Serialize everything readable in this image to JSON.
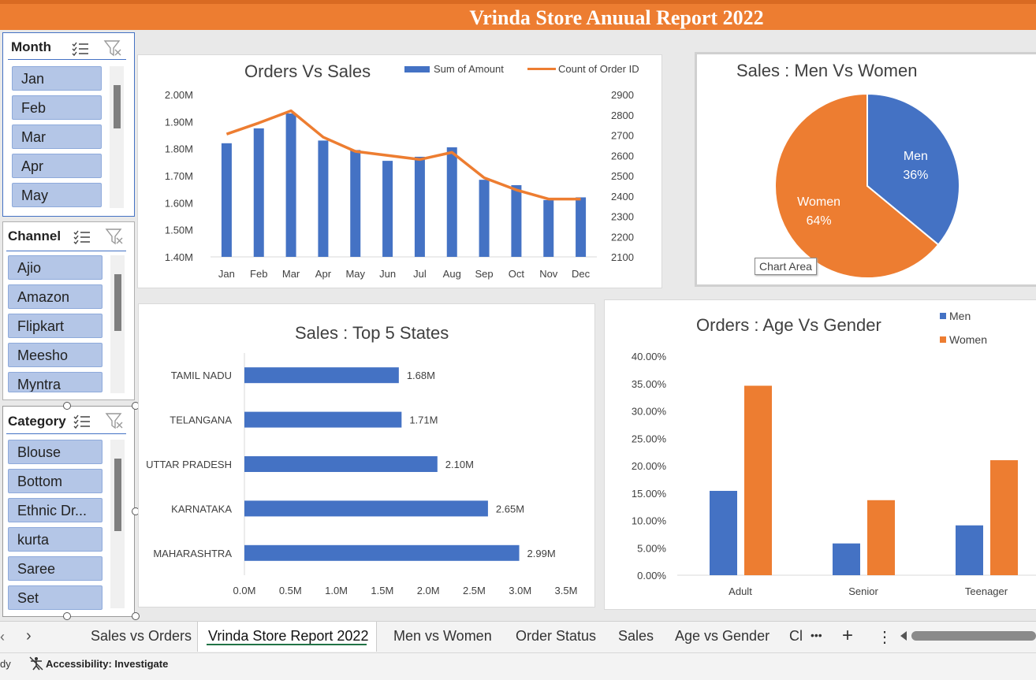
{
  "header": {
    "title": "Vrinda Store Anuual Report 2022"
  },
  "slicers": {
    "month": {
      "title": "Month",
      "items": [
        "Jan",
        "Feb",
        "Mar",
        "Apr",
        "May"
      ]
    },
    "channel": {
      "title": "Channel",
      "items": [
        "Ajio",
        "Amazon",
        "Flipkart",
        "Meesho",
        "Myntra"
      ]
    },
    "category": {
      "title": "Category",
      "items": [
        "Blouse",
        "Bottom",
        "Ethnic Dr...",
        "kurta",
        "Saree",
        "Set"
      ]
    }
  },
  "chart_data": [
    {
      "type": "bar",
      "title": "Orders Vs Sales",
      "categories": [
        "Jan",
        "Feb",
        "Mar",
        "Apr",
        "May",
        "Jun",
        "Jul",
        "Aug",
        "Sep",
        "Oct",
        "Nov",
        "Dec"
      ],
      "series": [
        {
          "name": "Sum of Amount",
          "type": "bar",
          "axis": "left",
          "color": "#4472c4",
          "values": [
            1.82,
            1.875,
            1.93,
            1.83,
            1.795,
            1.755,
            1.77,
            1.805,
            1.685,
            1.665,
            1.61,
            1.62
          ]
        },
        {
          "name": "Count of Order ID",
          "type": "line",
          "axis": "right",
          "color": "#ed7d31",
          "values": [
            2705,
            2760,
            2820,
            2690,
            2620,
            2600,
            2580,
            2615,
            2490,
            2430,
            2385,
            2385
          ]
        }
      ],
      "y_left_ticks": [
        "2.00M",
        "1.90M",
        "1.80M",
        "1.70M",
        "1.60M",
        "1.50M",
        "1.40M"
      ],
      "ylim_left": [
        1.4,
        2.0
      ],
      "y_right_ticks": [
        "2900",
        "2800",
        "2700",
        "2600",
        "2500",
        "2400",
        "2300",
        "2200",
        "2100"
      ],
      "ylim_right": [
        2100,
        2900
      ],
      "legend": "top-right"
    },
    {
      "type": "pie",
      "title": "Sales : Men Vs Women",
      "slices": [
        {
          "label": "Men",
          "pct_label": "36%",
          "value": 36,
          "color": "#4472c4"
        },
        {
          "label": "Women",
          "pct_label": "64%",
          "value": 64,
          "color": "#ed7d31"
        }
      ],
      "tooltip": "Chart Area"
    },
    {
      "type": "bar",
      "orientation": "horizontal",
      "title": "Sales : Top 5 States",
      "categories": [
        "TAMIL NADU",
        "TELANGANA",
        "UTTAR PRADESH",
        "KARNATAKA",
        "MAHARASHTRA"
      ],
      "values": [
        1.68,
        1.71,
        2.1,
        2.65,
        2.99
      ],
      "data_labels": [
        "1.68M",
        "1.71M",
        "2.10M",
        "2.65M",
        "2.99M"
      ],
      "x_ticks": [
        "0.0M",
        "0.5M",
        "1.0M",
        "1.5M",
        "2.0M",
        "2.5M",
        "3.0M",
        "3.5M"
      ],
      "xlim": [
        0,
        3.5
      ],
      "color": "#4472c4"
    },
    {
      "type": "bar",
      "title": "Orders : Age Vs Gender",
      "categories": [
        "Adult",
        "Senior",
        "Teenager"
      ],
      "series": [
        {
          "name": "Men",
          "color": "#4472c4",
          "values": [
            15.4,
            5.8,
            9.1
          ]
        },
        {
          "name": "Women",
          "color": "#ed7d31",
          "values": [
            34.6,
            13.7,
            21.0
          ]
        }
      ],
      "y_ticks": [
        "40.00%",
        "35.00%",
        "30.00%",
        "25.00%",
        "20.00%",
        "15.00%",
        "10.00%",
        "5.00%",
        "0.00%"
      ],
      "ylim": [
        0,
        40
      ],
      "legend": "top-right"
    }
  ],
  "tabs": {
    "items": [
      "Sales vs Orders",
      "Vrinda Store Report 2022",
      "Men vs Women",
      "Order Status",
      "Sales",
      "Age vs Gender",
      "Cl"
    ],
    "active": "Vrinda Store Report 2022",
    "more": "•••",
    "add": "+",
    "options": "⋮",
    "next": "›"
  },
  "status": {
    "ready": "dy",
    "accessibility": "Accessibility: Investigate"
  }
}
